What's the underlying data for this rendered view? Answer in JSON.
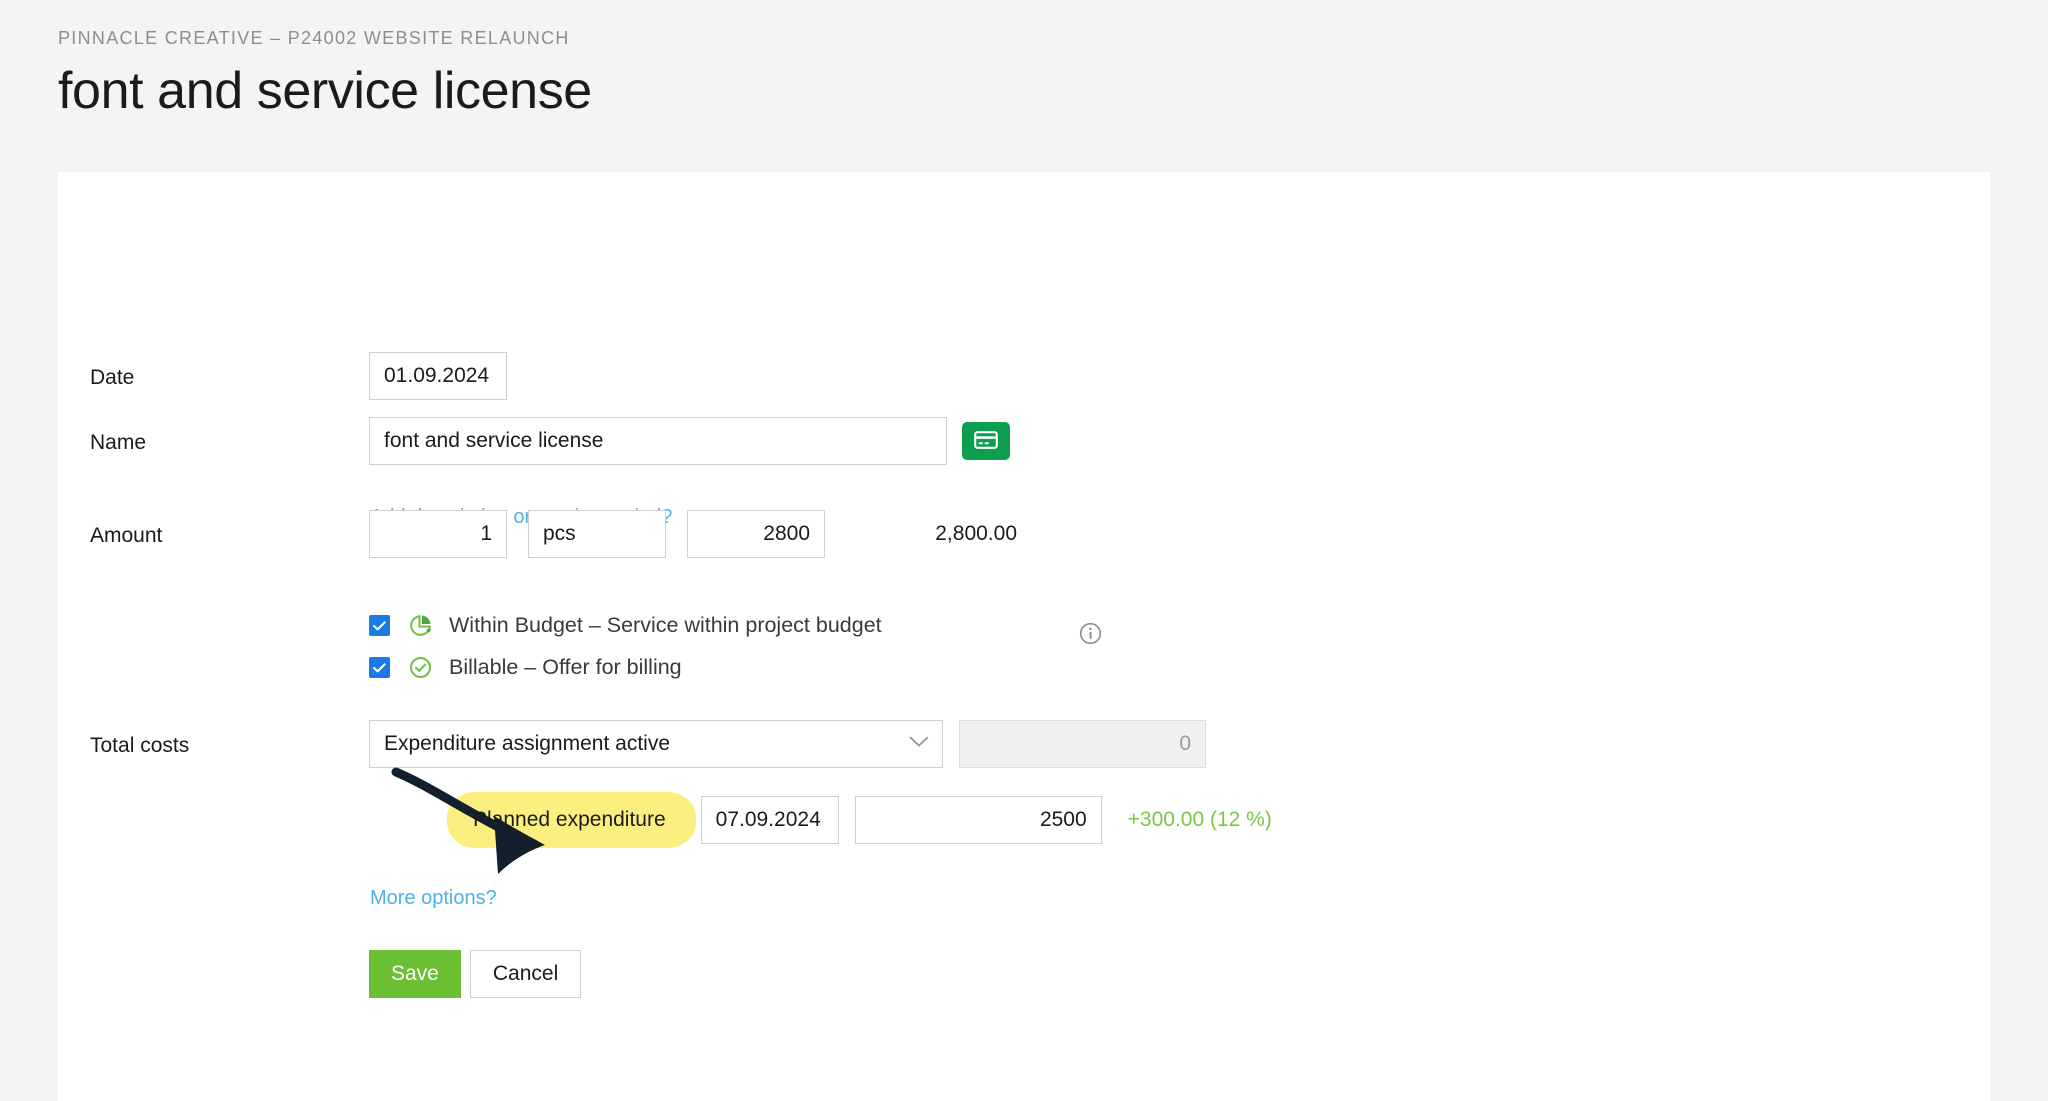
{
  "header": {
    "breadcrumb": "PINNACLE CREATIVE – P24002 WEBSITE RELAUNCH",
    "title": "font and service license"
  },
  "form": {
    "date": {
      "label": "Date",
      "value": "01.09.2024"
    },
    "name": {
      "label": "Name",
      "value": "font and service license",
      "icon_button": "credit-card-icon",
      "link": "Add description or service period?"
    },
    "amount": {
      "label": "Amount",
      "quantity": "1",
      "unit": "pcs",
      "unit_price": "2800",
      "total": "2,800.00"
    },
    "options": [
      {
        "label": "Within Budget – Service within project budget",
        "checked": true,
        "icon": "pie-chart-icon"
      },
      {
        "label": "Billable – Offer for billing",
        "checked": true,
        "icon": "check-circle-icon"
      }
    ],
    "info_icon": "info-icon",
    "total_costs": {
      "label": "Total costs",
      "assignment_select": "Expenditure assignment active",
      "assignment_amount": "0",
      "planned_label": "Planned expenditure",
      "planned_date": "07.09.2024",
      "planned_amount": "2500",
      "variance": "+300.00 (12 %)"
    },
    "more_options_link": "More options?",
    "buttons": {
      "save": "Save",
      "cancel": "Cancel"
    }
  },
  "annotation": {
    "arrow": "curved-arrow-annotation",
    "highlight_color": "#fbf07f",
    "arrow_color": "#141f2e"
  },
  "colors": {
    "accent_green": "#6cbe32",
    "icon_green": "#0e9e4f",
    "link_blue": "#4db2e8",
    "checkbox_blue": "#1a7ae8",
    "variance_green": "#7dc44a",
    "page_bg": "#f4f4f4"
  }
}
